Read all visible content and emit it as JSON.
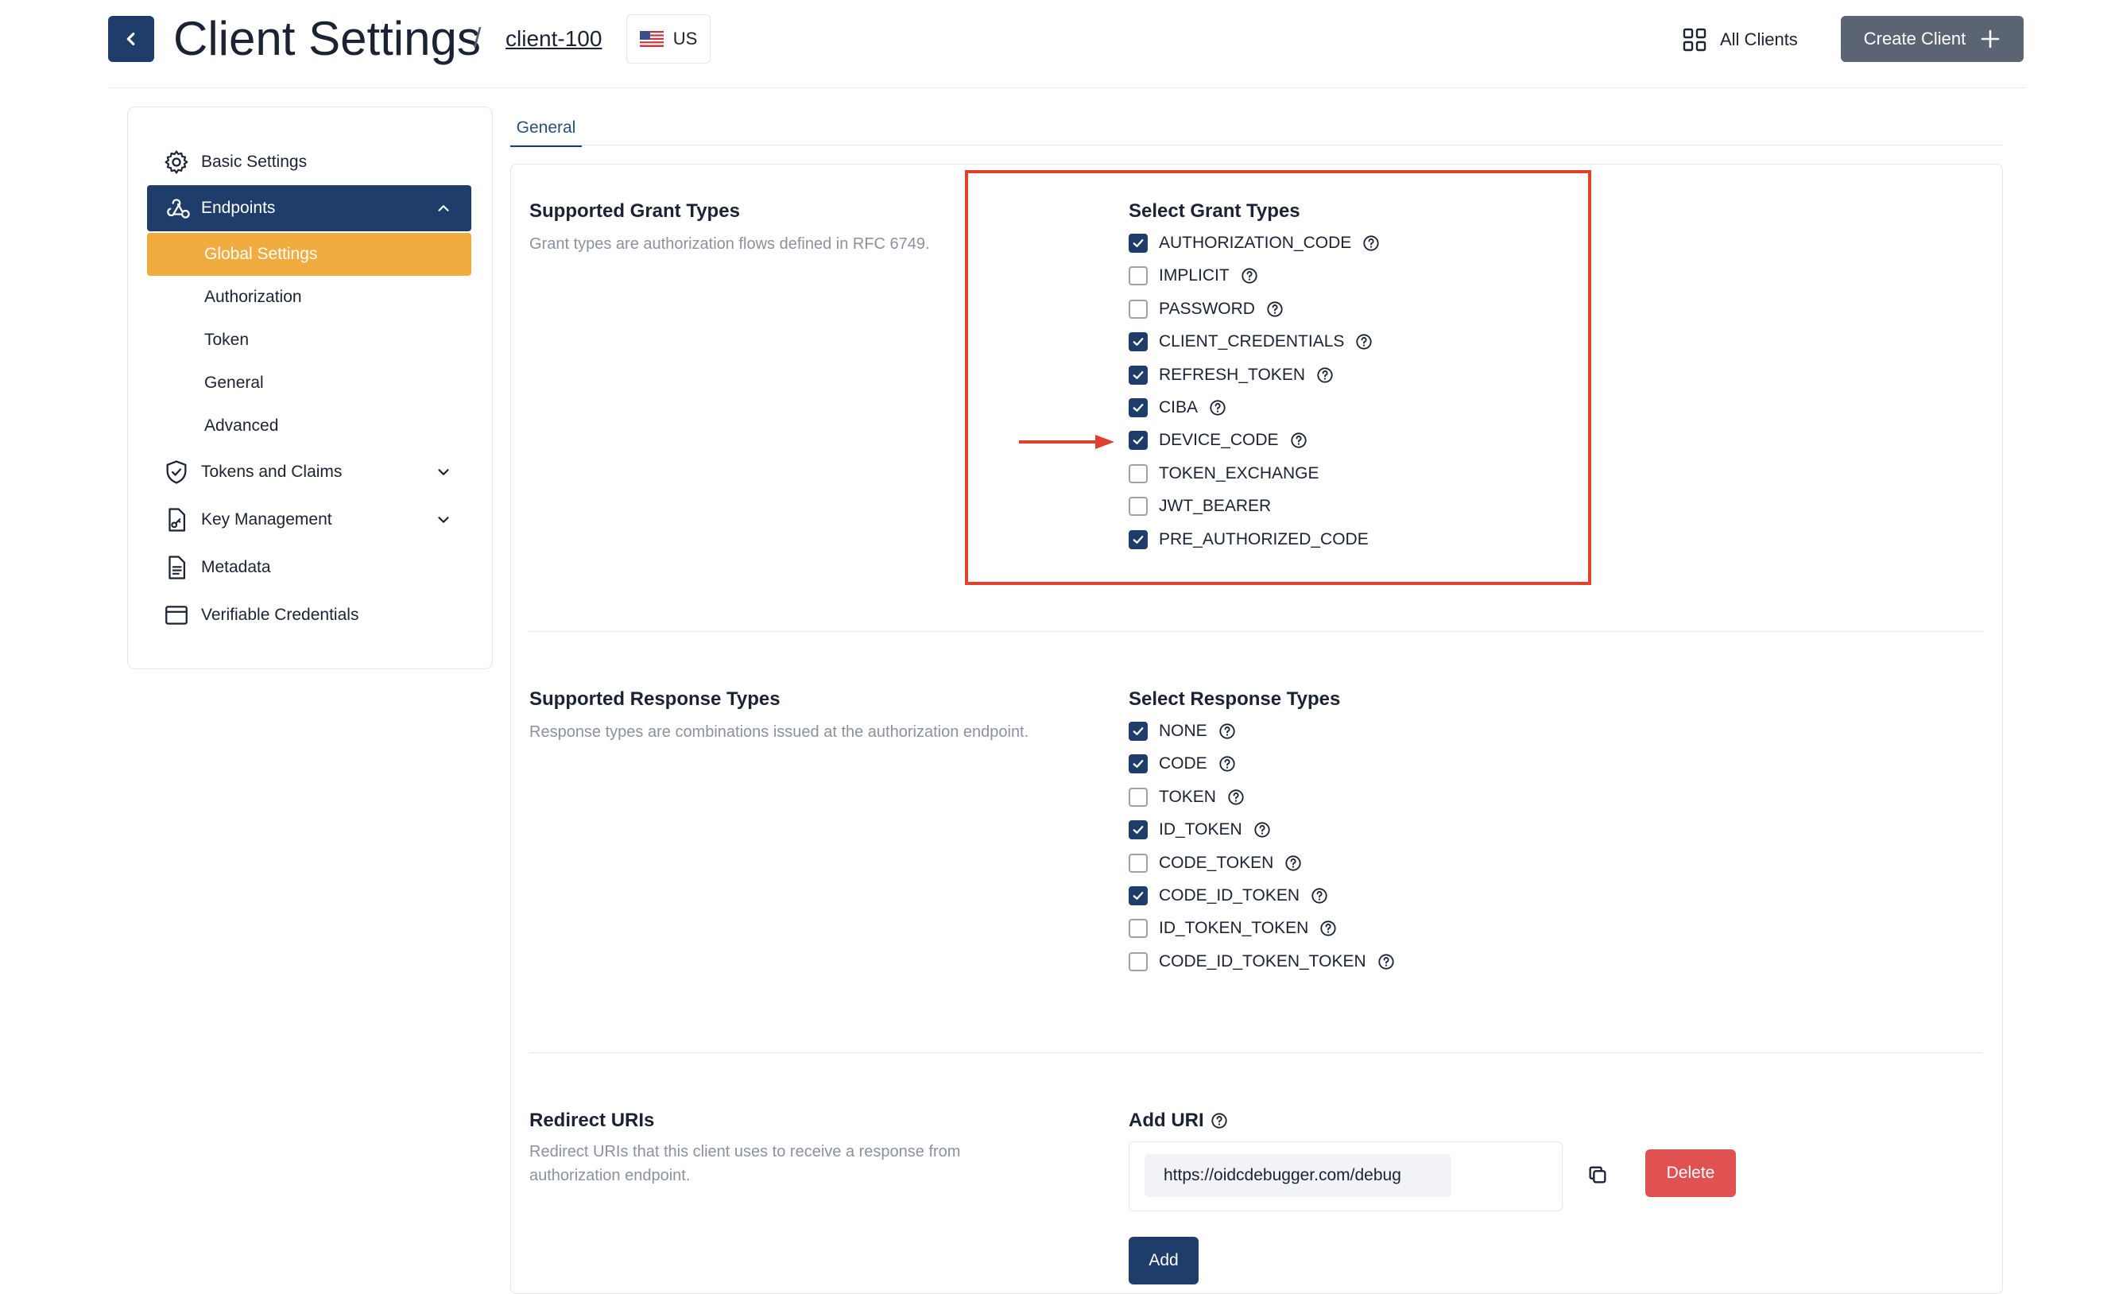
{
  "header": {
    "title": "Client Settings",
    "separator": "/",
    "client_id": "client-100",
    "region": "US",
    "all_clients_label": "All Clients",
    "create_client_label": "Create Client"
  },
  "sidebar": {
    "basic_settings": "Basic Settings",
    "endpoints": "Endpoints",
    "endpoint_items": [
      "Global Settings",
      "Authorization",
      "Token",
      "General",
      "Advanced"
    ],
    "tokens_and_claims": "Tokens and Claims",
    "key_management": "Key Management",
    "metadata": "Metadata",
    "verifiable_credentials": "Verifiable Credentials"
  },
  "tabs": {
    "general": "General"
  },
  "grant_types": {
    "title": "Supported Grant Types",
    "description": "Grant types are authorization flows defined in RFC 6749.",
    "select_title": "Select Grant Types",
    "options": [
      {
        "label": "AUTHORIZATION_CODE",
        "checked": true,
        "help": true
      },
      {
        "label": "IMPLICIT",
        "checked": false,
        "help": true
      },
      {
        "label": "PASSWORD",
        "checked": false,
        "help": true
      },
      {
        "label": "CLIENT_CREDENTIALS",
        "checked": true,
        "help": true
      },
      {
        "label": "REFRESH_TOKEN",
        "checked": true,
        "help": true
      },
      {
        "label": "CIBA",
        "checked": true,
        "help": true
      },
      {
        "label": "DEVICE_CODE",
        "checked": true,
        "help": true
      },
      {
        "label": "TOKEN_EXCHANGE",
        "checked": false,
        "help": false
      },
      {
        "label": "JWT_BEARER",
        "checked": false,
        "help": false
      },
      {
        "label": "PRE_AUTHORIZED_CODE",
        "checked": true,
        "help": false
      }
    ]
  },
  "response_types": {
    "title": "Supported Response Types",
    "description": "Response types are combinations issued at the authorization endpoint.",
    "select_title": "Select Response Types",
    "options": [
      {
        "label": "NONE",
        "checked": true
      },
      {
        "label": "CODE",
        "checked": true
      },
      {
        "label": "TOKEN",
        "checked": false
      },
      {
        "label": "ID_TOKEN",
        "checked": true
      },
      {
        "label": "CODE_TOKEN",
        "checked": false
      },
      {
        "label": "CODE_ID_TOKEN",
        "checked": true
      },
      {
        "label": "ID_TOKEN_TOKEN",
        "checked": false
      },
      {
        "label": "CODE_ID_TOKEN_TOKEN",
        "checked": false
      }
    ]
  },
  "redirect_uris": {
    "title": "Redirect URIs",
    "description": "Redirect URIs that this client uses to receive a response from authorization endpoint.",
    "add_uri_label": "Add URI",
    "uri_value": "https://oidcdebugger.com/debug",
    "delete_label": "Delete",
    "add_label": "Add"
  },
  "colors": {
    "primary": "#1e3d6b",
    "accent": "#f0ac3e",
    "danger": "#e05252",
    "annotation": "#e0412e"
  }
}
